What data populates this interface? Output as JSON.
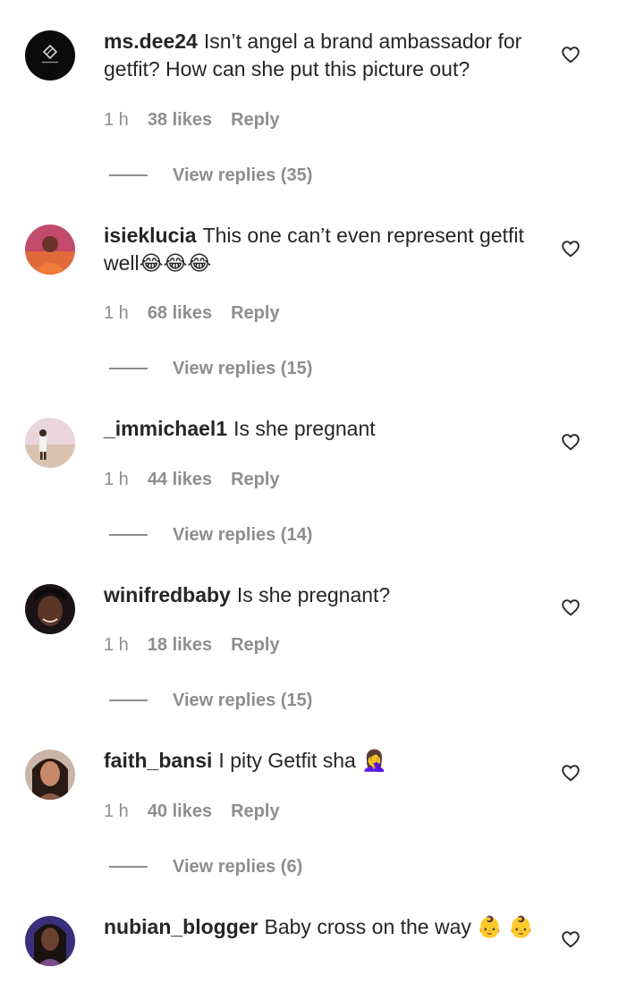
{
  "comments": [
    {
      "username": "ms.dee24",
      "text": "Isn’t angel a brand ambassador for getfit? How can she put this picture out?",
      "time": "1 h",
      "likes": "38 likes",
      "reply": "Reply",
      "view_replies": "View replies (35)"
    },
    {
      "username": "isieklucia",
      "text": "This one can’t even represent getfit well😂😂😂",
      "time": "1 h",
      "likes": "68 likes",
      "reply": "Reply",
      "view_replies": "View replies (15)"
    },
    {
      "username": "_immichael1",
      "text": "Is she pregnant",
      "time": "1 h",
      "likes": "44 likes",
      "reply": "Reply",
      "view_replies": "View replies (14)"
    },
    {
      "username": "winifredbaby",
      "text": "Is she pregnant?",
      "time": "1 h",
      "likes": "18 likes",
      "reply": "Reply",
      "view_replies": "View replies (15)"
    },
    {
      "username": "faith_bansi",
      "text": "I pity Getfit sha 🤦‍♀️",
      "time": "1 h",
      "likes": "40 likes",
      "reply": "Reply",
      "view_replies": "View replies (6)"
    },
    {
      "username": "nubian_blogger",
      "text": "Baby cross on the way 👶 👶"
    }
  ],
  "icons": {
    "like": "heart-outline-icon"
  },
  "colors": {
    "text": "#262626",
    "secondary": "#8e8e8e",
    "background": "#ffffff"
  }
}
